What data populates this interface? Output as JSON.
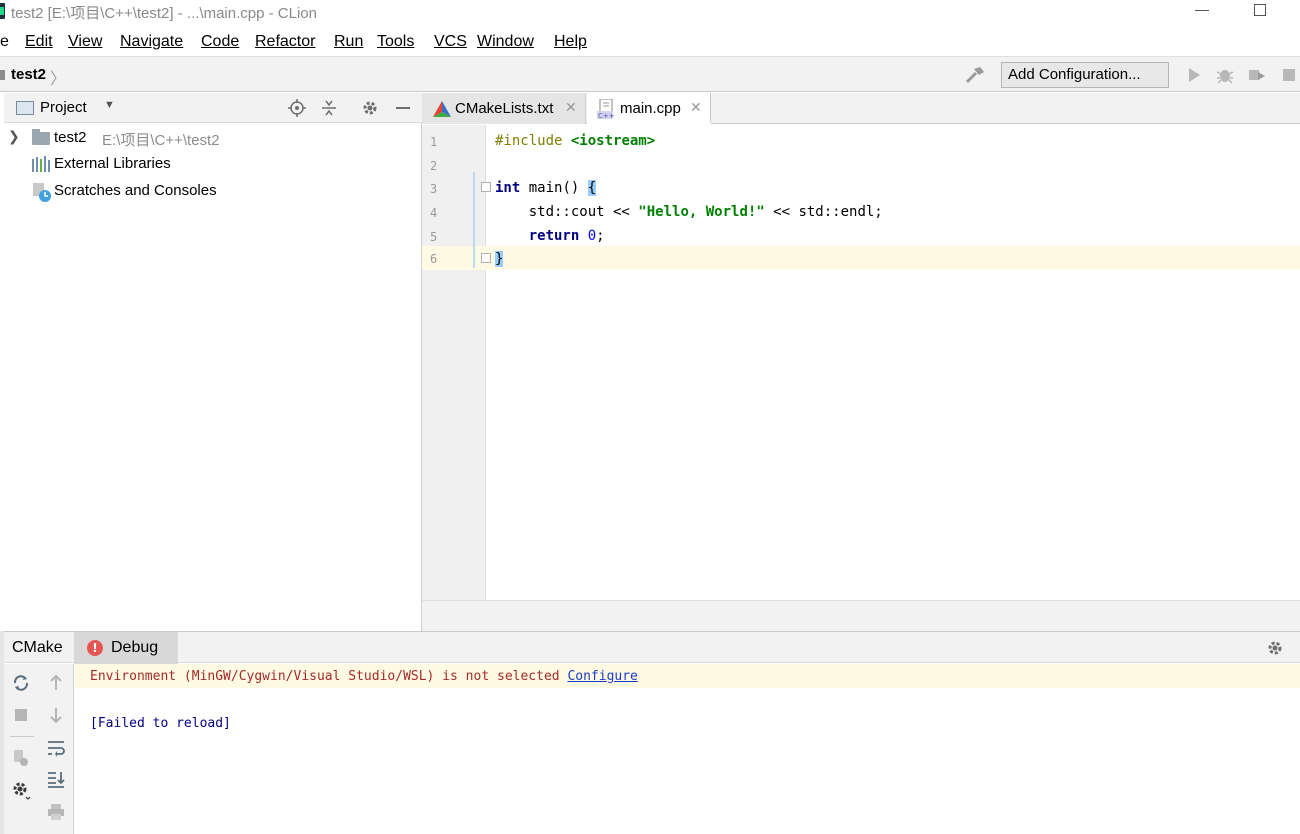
{
  "window": {
    "title": "test2 [E:\\项目\\C++\\test2] - ...\\main.cpp - CLion"
  },
  "menu": {
    "items": [
      "e",
      "Edit",
      "View",
      "Navigate",
      "Code",
      "Refactor",
      "Run",
      "Tools",
      "VCS",
      "Window",
      "Help"
    ]
  },
  "navbar": {
    "breadcrumb": "test2",
    "add_configuration": "Add Configuration..."
  },
  "project_panel": {
    "title": "Project",
    "tree": [
      {
        "label": "test2",
        "path": "E:\\项目\\C++\\test2",
        "icon": "folder-icon",
        "expandable": true
      },
      {
        "label": "External Libraries",
        "icon": "library-icon"
      },
      {
        "label": "Scratches and Consoles",
        "icon": "scratch-icon"
      }
    ]
  },
  "editor": {
    "tabs": [
      {
        "label": "CMakeLists.txt",
        "icon": "cmake-icon",
        "active": false
      },
      {
        "label": "main.cpp",
        "icon": "cpp-file-icon",
        "active": true
      }
    ],
    "line_numbers": [
      "1",
      "2",
      "3",
      "4",
      "5",
      "6"
    ],
    "code": {
      "l1_directive": "#include",
      "l1_header": "<iostream>",
      "l3_type": "int",
      "l3_rest": " main() ",
      "l3_brace": "{",
      "l4_pre": "    std::cout << ",
      "l4_string": "\"Hello, World!\"",
      "l4_post": " << std::endl;",
      "l5_keyword": "return",
      "l5_num": "0",
      "l5_end": ";",
      "l6_brace": "}"
    }
  },
  "bottom_panel": {
    "tabs": [
      {
        "label": "CMake",
        "active": false
      },
      {
        "label": "Debug",
        "active": true,
        "icon": "error-icon"
      }
    ],
    "error_icon_glyph": "!",
    "warning": "Environment (MinGW/Cygwin/Visual Studio/WSL) is not selected ",
    "configure_link": "Configure",
    "status": "[Failed to reload]"
  },
  "colors": {
    "keyword": "#000080",
    "string": "#008000",
    "number": "#0000ff",
    "caret_line": "#fffae3",
    "error": "#e55757"
  }
}
